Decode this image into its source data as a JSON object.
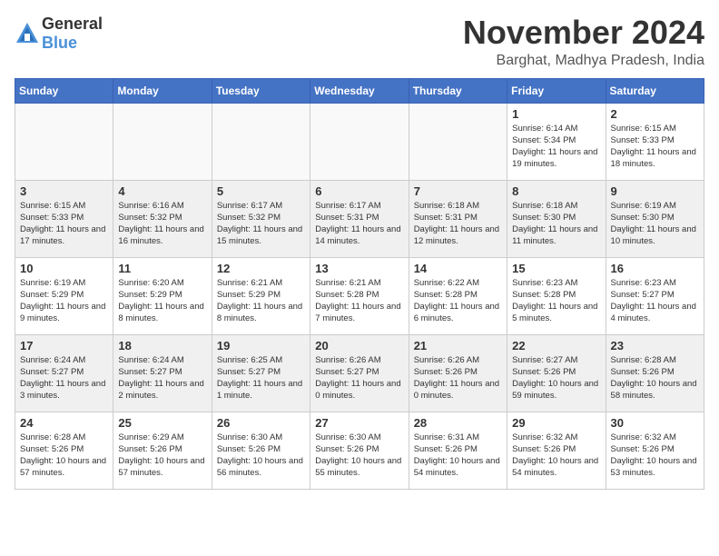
{
  "logo": {
    "general": "General",
    "blue": "Blue"
  },
  "header": {
    "month": "November 2024",
    "location": "Barghat, Madhya Pradesh, India"
  },
  "weekdays": [
    "Sunday",
    "Monday",
    "Tuesday",
    "Wednesday",
    "Thursday",
    "Friday",
    "Saturday"
  ],
  "weeks": [
    [
      {
        "day": "",
        "detail": ""
      },
      {
        "day": "",
        "detail": ""
      },
      {
        "day": "",
        "detail": ""
      },
      {
        "day": "",
        "detail": ""
      },
      {
        "day": "",
        "detail": ""
      },
      {
        "day": "1",
        "detail": "Sunrise: 6:14 AM\nSunset: 5:34 PM\nDaylight: 11 hours and 19 minutes."
      },
      {
        "day": "2",
        "detail": "Sunrise: 6:15 AM\nSunset: 5:33 PM\nDaylight: 11 hours and 18 minutes."
      }
    ],
    [
      {
        "day": "3",
        "detail": "Sunrise: 6:15 AM\nSunset: 5:33 PM\nDaylight: 11 hours and 17 minutes."
      },
      {
        "day": "4",
        "detail": "Sunrise: 6:16 AM\nSunset: 5:32 PM\nDaylight: 11 hours and 16 minutes."
      },
      {
        "day": "5",
        "detail": "Sunrise: 6:17 AM\nSunset: 5:32 PM\nDaylight: 11 hours and 15 minutes."
      },
      {
        "day": "6",
        "detail": "Sunrise: 6:17 AM\nSunset: 5:31 PM\nDaylight: 11 hours and 14 minutes."
      },
      {
        "day": "7",
        "detail": "Sunrise: 6:18 AM\nSunset: 5:31 PM\nDaylight: 11 hours and 12 minutes."
      },
      {
        "day": "8",
        "detail": "Sunrise: 6:18 AM\nSunset: 5:30 PM\nDaylight: 11 hours and 11 minutes."
      },
      {
        "day": "9",
        "detail": "Sunrise: 6:19 AM\nSunset: 5:30 PM\nDaylight: 11 hours and 10 minutes."
      }
    ],
    [
      {
        "day": "10",
        "detail": "Sunrise: 6:19 AM\nSunset: 5:29 PM\nDaylight: 11 hours and 9 minutes."
      },
      {
        "day": "11",
        "detail": "Sunrise: 6:20 AM\nSunset: 5:29 PM\nDaylight: 11 hours and 8 minutes."
      },
      {
        "day": "12",
        "detail": "Sunrise: 6:21 AM\nSunset: 5:29 PM\nDaylight: 11 hours and 8 minutes."
      },
      {
        "day": "13",
        "detail": "Sunrise: 6:21 AM\nSunset: 5:28 PM\nDaylight: 11 hours and 7 minutes."
      },
      {
        "day": "14",
        "detail": "Sunrise: 6:22 AM\nSunset: 5:28 PM\nDaylight: 11 hours and 6 minutes."
      },
      {
        "day": "15",
        "detail": "Sunrise: 6:23 AM\nSunset: 5:28 PM\nDaylight: 11 hours and 5 minutes."
      },
      {
        "day": "16",
        "detail": "Sunrise: 6:23 AM\nSunset: 5:27 PM\nDaylight: 11 hours and 4 minutes."
      }
    ],
    [
      {
        "day": "17",
        "detail": "Sunrise: 6:24 AM\nSunset: 5:27 PM\nDaylight: 11 hours and 3 minutes."
      },
      {
        "day": "18",
        "detail": "Sunrise: 6:24 AM\nSunset: 5:27 PM\nDaylight: 11 hours and 2 minutes."
      },
      {
        "day": "19",
        "detail": "Sunrise: 6:25 AM\nSunset: 5:27 PM\nDaylight: 11 hours and 1 minute."
      },
      {
        "day": "20",
        "detail": "Sunrise: 6:26 AM\nSunset: 5:27 PM\nDaylight: 11 hours and 0 minutes."
      },
      {
        "day": "21",
        "detail": "Sunrise: 6:26 AM\nSunset: 5:26 PM\nDaylight: 11 hours and 0 minutes."
      },
      {
        "day": "22",
        "detail": "Sunrise: 6:27 AM\nSunset: 5:26 PM\nDaylight: 10 hours and 59 minutes."
      },
      {
        "day": "23",
        "detail": "Sunrise: 6:28 AM\nSunset: 5:26 PM\nDaylight: 10 hours and 58 minutes."
      }
    ],
    [
      {
        "day": "24",
        "detail": "Sunrise: 6:28 AM\nSunset: 5:26 PM\nDaylight: 10 hours and 57 minutes."
      },
      {
        "day": "25",
        "detail": "Sunrise: 6:29 AM\nSunset: 5:26 PM\nDaylight: 10 hours and 57 minutes."
      },
      {
        "day": "26",
        "detail": "Sunrise: 6:30 AM\nSunset: 5:26 PM\nDaylight: 10 hours and 56 minutes."
      },
      {
        "day": "27",
        "detail": "Sunrise: 6:30 AM\nSunset: 5:26 PM\nDaylight: 10 hours and 55 minutes."
      },
      {
        "day": "28",
        "detail": "Sunrise: 6:31 AM\nSunset: 5:26 PM\nDaylight: 10 hours and 54 minutes."
      },
      {
        "day": "29",
        "detail": "Sunrise: 6:32 AM\nSunset: 5:26 PM\nDaylight: 10 hours and 54 minutes."
      },
      {
        "day": "30",
        "detail": "Sunrise: 6:32 AM\nSunset: 5:26 PM\nDaylight: 10 hours and 53 minutes."
      }
    ]
  ]
}
